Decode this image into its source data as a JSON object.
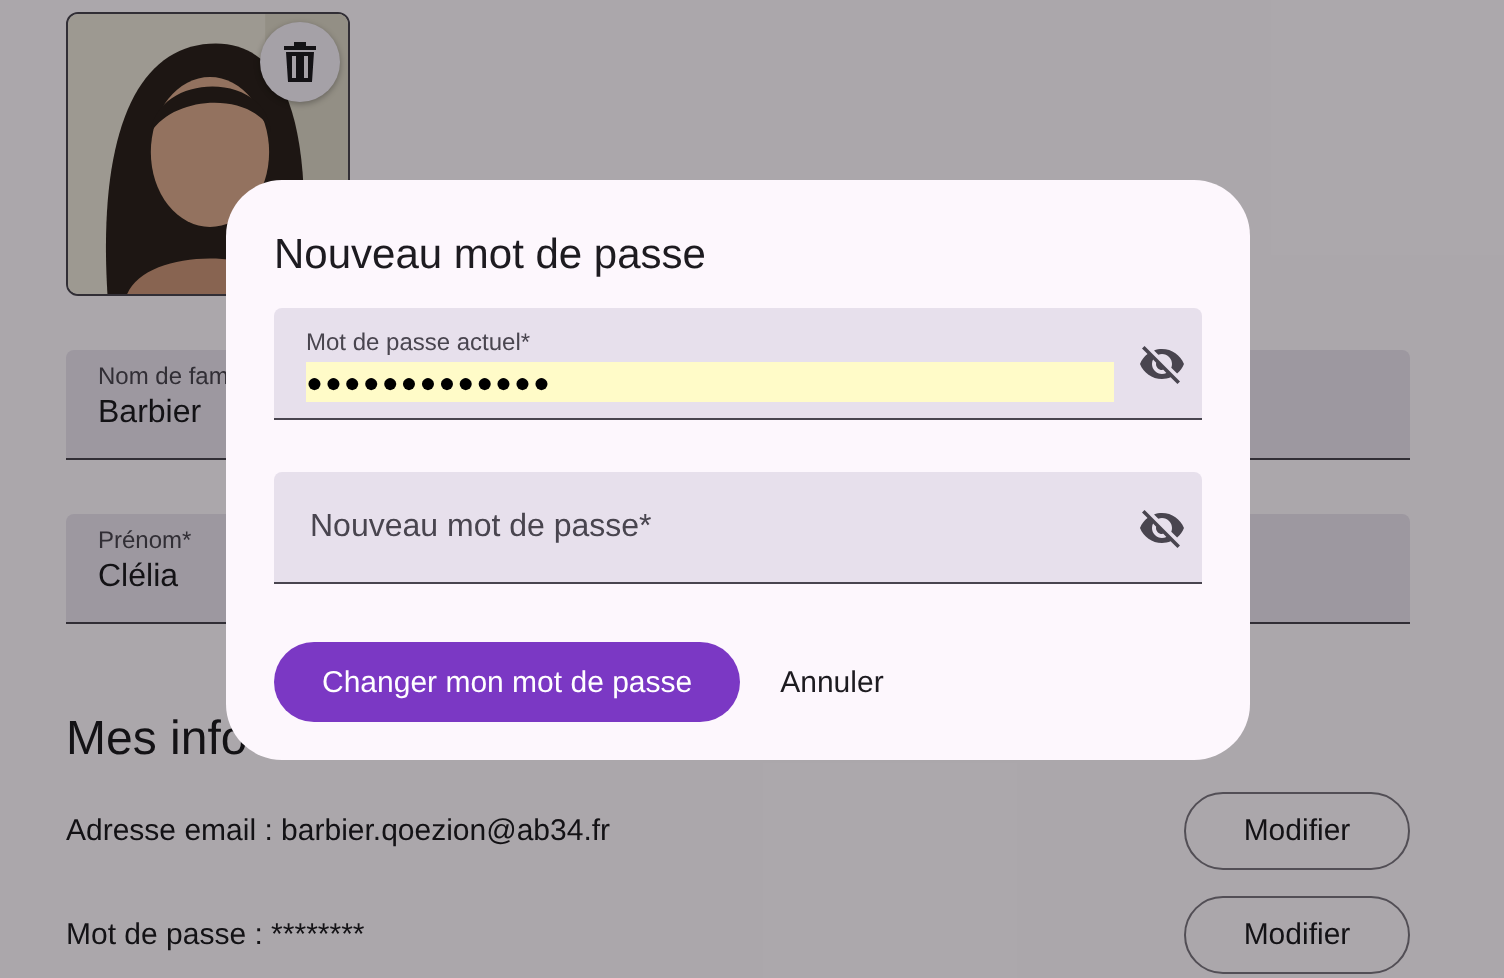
{
  "fields": [
    {
      "label": "Nom de fam",
      "value": "Barbier"
    },
    {
      "label": "Prénom*",
      "value": "Clélia"
    }
  ],
  "section": {
    "title": "Mes info",
    "rows": [
      {
        "text": "Adresse email : barbier.qoezion@ab34.fr",
        "button": "Modifier"
      },
      {
        "text": "Mot de passe : ********",
        "button": "Modifier"
      }
    ]
  },
  "dialog": {
    "title": "Nouveau mot de passe",
    "fields": [
      {
        "label": "Mot de passe actuel*",
        "value": "●●●●●●●●●●●●●",
        "autofilled": true
      },
      {
        "placeholder": "Nouveau mot de passe*"
      }
    ],
    "primary_button": "Changer mon mot de passe",
    "secondary_button": "Annuler"
  }
}
